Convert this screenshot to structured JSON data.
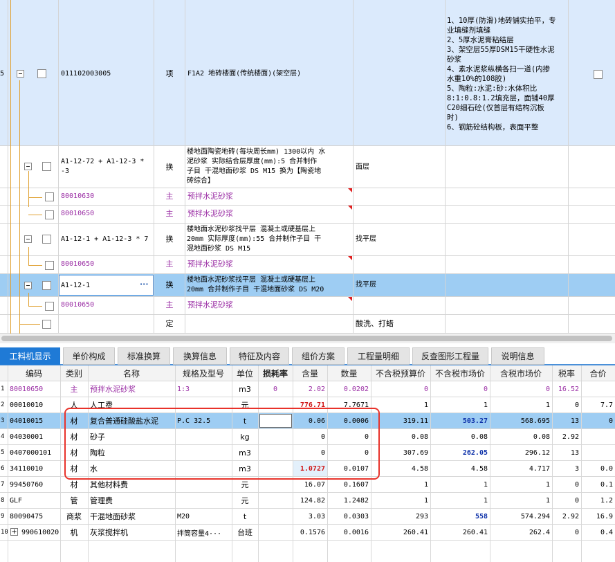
{
  "upper_grid": {
    "row_main": {
      "index": "5",
      "code": "011102003005",
      "type": "项",
      "name": "F1A2 地砖楼面(传统楼面)(架空层)",
      "feature_lines": [
        "1、10厚(防滑)地砖铺实拍平，专",
        "业填缝剂填缝",
        "2、5厚水泥膏粘结层",
        "3、架空层55厚DSM15干硬性水泥",
        "砂浆",
        "4、素水泥浆纵横各扫一道(内掺",
        "水重10%的108胶)",
        "5、陶粒:水泥:砂:水体积比",
        "8:1:0.8:1.2填充层，面铺40厚",
        "C20细石砼(仅首层有结构沉板",
        "时)",
        "6、钢筋砼结构板，表面平整"
      ]
    },
    "rows": [
      {
        "code": "A1-12-72 + A1-12-3 * -3",
        "type": "换",
        "name_lines": [
          "楼地面陶瓷地砖(每块周长mm) 1300以内 水",
          "泥砂浆  实际结合层厚度(mm):5  合并制作",
          "子目 干混地面砂浆 DS M15  换为【陶瓷地",
          "砖综合】"
        ],
        "feature": "面层"
      },
      {
        "code": "80010630",
        "type": "主",
        "name": "预拌水泥砂浆"
      },
      {
        "code": "80010650",
        "type": "主",
        "name": "预拌水泥砂浆"
      },
      {
        "code": "A1-12-1 + A1-12-3 * 7",
        "type": "换",
        "name_lines": [
          "楼地面水泥砂浆找平层 混凝土或硬基层上",
          "20mm  实际厚度(mm):55  合并制作子目 干",
          "混地面砂浆 DS M15"
        ],
        "feature": "找平层"
      },
      {
        "code": "80010650",
        "type": "主",
        "name": "预拌水泥砂浆"
      },
      {
        "code": "A1-12-1",
        "ellipsis": "···",
        "type": "换",
        "name_lines": [
          "楼地面水泥砂浆找平层 混凝土或硬基层上",
          "20mm  合并制作子目 干混地面砂浆 DS M20"
        ],
        "feature": "找平层"
      },
      {
        "code": "80010650",
        "type": "主",
        "name": "预拌水泥砂浆"
      },
      {
        "code": "",
        "type": "定",
        "name": "",
        "feature": "酸洗、打蜡"
      }
    ]
  },
  "tabs": [
    {
      "label": "工料机显示",
      "active": true
    },
    {
      "label": "单价构成",
      "active": false
    },
    {
      "label": "标准换算",
      "active": false
    },
    {
      "label": "换算信息",
      "active": false
    },
    {
      "label": "特征及内容",
      "active": false
    },
    {
      "label": "组价方案",
      "active": false
    },
    {
      "label": "工程量明细",
      "active": false
    },
    {
      "label": "反查图形工程量",
      "active": false
    },
    {
      "label": "说明信息",
      "active": false
    }
  ],
  "lower_grid": {
    "headers": [
      "编码",
      "类别",
      "名称",
      "规格及型号",
      "单位",
      "损耗率",
      "含量",
      "数量",
      "不含税预算价",
      "不含税市场价",
      "含税市场价",
      "税率",
      "合价"
    ],
    "rows": [
      {
        "idx": "1",
        "code": "80010650",
        "cat": "主",
        "name": "预拌水泥砂浆",
        "spec": "1:3",
        "unit": "m3",
        "loss": "0",
        "content": "2.02",
        "qty": "0.0202",
        "budget": "0",
        "market": "0",
        "taxmarket": "0",
        "tax": "16.52",
        "total": ""
      },
      {
        "idx": "2",
        "code": "00010010",
        "cat": "人",
        "name": "人工费",
        "spec": "",
        "unit": "元",
        "loss": "",
        "content": "776.71",
        "qty": "7.7671",
        "budget": "1",
        "market": "1",
        "taxmarket": "1",
        "tax": "0",
        "total": "7.7"
      },
      {
        "idx": "3",
        "code": "04010015",
        "cat": "材",
        "name": "复合普通硅酸盐水泥",
        "spec": "P.C 32.5",
        "unit": "t",
        "loss": "",
        "content": "0.06",
        "qty": "0.0006",
        "budget": "319.11",
        "market": "503.27",
        "taxmarket": "568.695",
        "tax": "13",
        "total": "0"
      },
      {
        "idx": "4",
        "code": "04030001",
        "cat": "材",
        "name": "砂子",
        "spec": "",
        "unit": "kg",
        "loss": "",
        "content": "0",
        "qty": "0",
        "budget": "0.08",
        "market": "0.08",
        "taxmarket": "0.08",
        "tax": "2.92",
        "total": ""
      },
      {
        "idx": "5",
        "code": "0407000101",
        "cat": "材",
        "name": "陶粒",
        "spec": "",
        "unit": "m3",
        "loss": "",
        "content": "0",
        "qty": "0",
        "budget": "307.69",
        "market": "262.05",
        "taxmarket": "296.12",
        "tax": "13",
        "total": ""
      },
      {
        "idx": "6",
        "code": "34110010",
        "cat": "材",
        "name": "水",
        "spec": "",
        "unit": "m3",
        "loss": "",
        "content": "1.0727",
        "qty": "0.0107",
        "budget": "4.58",
        "market": "4.58",
        "taxmarket": "4.717",
        "tax": "3",
        "total": "0.0"
      },
      {
        "idx": "7",
        "code": "99450760",
        "cat": "材",
        "name": "其他材料费",
        "spec": "",
        "unit": "元",
        "loss": "",
        "content": "16.07",
        "qty": "0.1607",
        "budget": "1",
        "market": "1",
        "taxmarket": "1",
        "tax": "0",
        "total": "0.1"
      },
      {
        "idx": "8",
        "code": "GLF",
        "cat": "管",
        "name": "管理费",
        "spec": "",
        "unit": "元",
        "loss": "",
        "content": "124.82",
        "qty": "1.2482",
        "budget": "1",
        "market": "1",
        "taxmarket": "1",
        "tax": "0",
        "total": "1.2"
      },
      {
        "idx": "9",
        "code": "80090475",
        "cat": "商浆",
        "name": "干混地面砂浆",
        "spec": "M20",
        "unit": "t",
        "loss": "",
        "content": "3.03",
        "qty": "0.0303",
        "budget": "293",
        "market": "558",
        "taxmarket": "574.294",
        "tax": "2.92",
        "total": "16.9"
      },
      {
        "idx": "10",
        "code": "990610020",
        "cat": "机",
        "name": "灰浆搅拌机",
        "spec": "拌筒容量4···",
        "unit": "台班",
        "loss": "",
        "content": "0.1576",
        "qty": "0.0016",
        "budget": "260.41",
        "market": "260.41",
        "taxmarket": "262.4",
        "tax": "0",
        "total": "0.4"
      }
    ]
  }
}
